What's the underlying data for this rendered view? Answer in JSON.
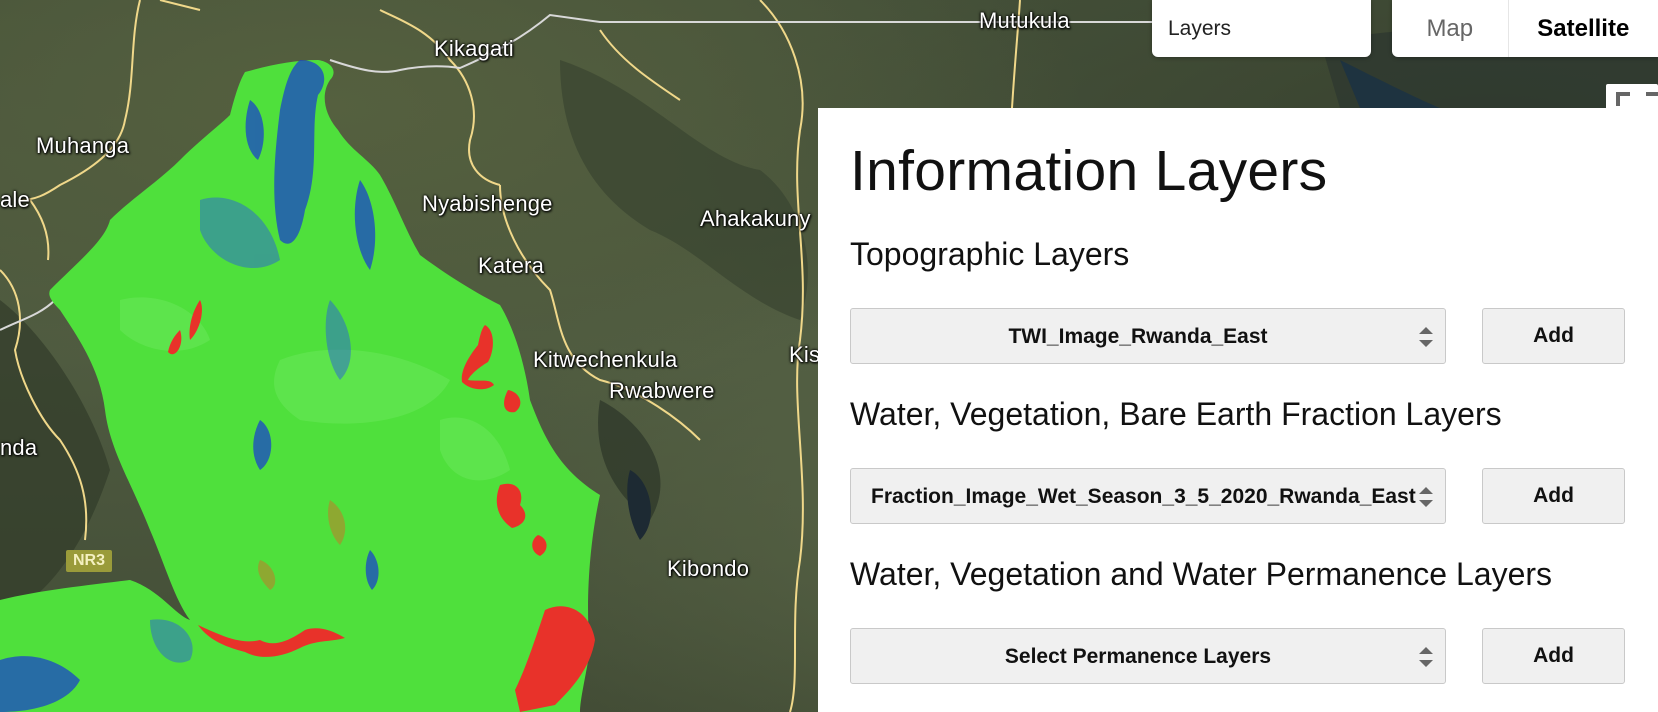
{
  "map": {
    "places": [
      "Mutukula",
      "Kikagati",
      "Muhanga",
      "Nyabishenge",
      "Ahakakuny",
      "ale",
      "Katera",
      "Kitwechenkula",
      "Rwabwere",
      "Kis",
      "nda",
      "Kibondo"
    ],
    "road_shield": "NR3",
    "colors": {
      "vegetation": "#4fe03c",
      "water": "#1a45c8",
      "bare_earth": "#e8322a",
      "border": "#f0d88a"
    }
  },
  "controls": {
    "layers_label": "Layers",
    "map_type_map": "Map",
    "map_type_satellite": "Satellite",
    "fullscreen_icon": "fullscreen-icon"
  },
  "panel": {
    "title": "Information Layers",
    "sections": [
      {
        "heading": "Topographic Layers",
        "selected": "TWI_Image_Rwanda_East",
        "button": "Add"
      },
      {
        "heading": "Water, Vegetation, Bare Earth Fraction Layers",
        "selected": "Fraction_Image_Wet_Season_3_5_2020_Rwanda_East",
        "button": "Add"
      },
      {
        "heading": "Water, Vegetation and Water Permanence Layers",
        "selected": "Select Permanence Layers",
        "button": "Add"
      }
    ]
  }
}
